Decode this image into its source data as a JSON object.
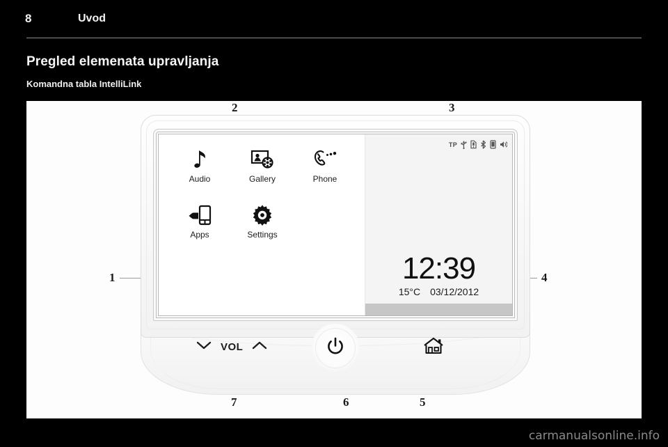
{
  "header": {
    "page_number": "8",
    "chapter": "Uvod"
  },
  "titles": {
    "h1": "Pregled elemenata upravljanja",
    "h2": "Komandna tabla IntelliLink"
  },
  "callouts": [
    {
      "id": "callout-1",
      "label": "1"
    },
    {
      "id": "callout-2",
      "label": "2"
    },
    {
      "id": "callout-3",
      "label": "3"
    },
    {
      "id": "callout-4",
      "label": "4"
    },
    {
      "id": "callout-5",
      "label": "5"
    },
    {
      "id": "callout-6",
      "label": "6"
    },
    {
      "id": "callout-7",
      "label": "7"
    }
  ],
  "device": {
    "screen": {
      "apps": [
        {
          "label": "Audio",
          "icon": "music-note-icon"
        },
        {
          "label": "Gallery",
          "icon": "photo-film-icon"
        },
        {
          "label": "Phone",
          "icon": "phone-handset-icon"
        },
        {
          "label": "Apps",
          "icon": "hand-smartphone-icon"
        },
        {
          "label": "Settings",
          "icon": "gear-icon"
        }
      ],
      "status_bar": {
        "tp_label": "TP",
        "icons": [
          "usb-icon",
          "sd-card-icon",
          "bluetooth-icon",
          "phone-battery-icon",
          "speaker-mute-icon"
        ]
      },
      "clock": {
        "time": "12:39",
        "temperature": "15°C",
        "date": "03/12/2012"
      }
    },
    "controls": {
      "volume_down_icon": "chevron-down-icon",
      "volume_label": "VOL",
      "volume_up_icon": "chevron-up-icon",
      "power_icon": "power-icon",
      "home_icon": "home-icon"
    }
  },
  "footer": {
    "watermark": "carmanualsonline.info"
  }
}
